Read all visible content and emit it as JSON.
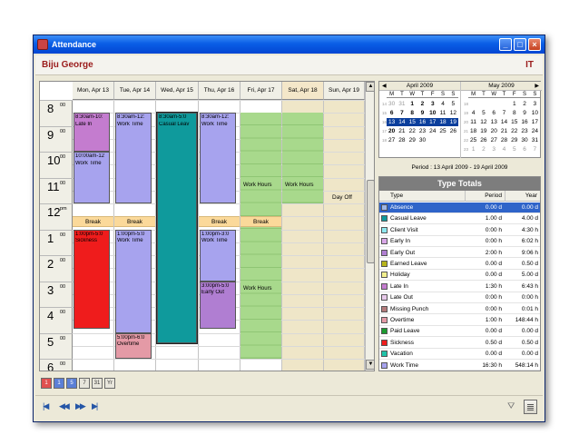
{
  "window": {
    "title": "Attendance"
  },
  "header": {
    "user": "Biju George",
    "dept": "IT"
  },
  "days": [
    {
      "label": "Mon, Apr 13",
      "weekend": false
    },
    {
      "label": "Tue, Apr 14",
      "weekend": false
    },
    {
      "label": "Wed, Apr 15",
      "weekend": false
    },
    {
      "label": "Thu, Apr 16",
      "weekend": false
    },
    {
      "label": "Fri, Apr 17",
      "weekend": false
    },
    {
      "label": "Sat, Apr 18",
      "weekend": true
    },
    {
      "label": "Sun, Apr 19",
      "weekend": false
    }
  ],
  "hours": [
    {
      "num": "8",
      "min": "00"
    },
    {
      "num": "9",
      "min": "00"
    },
    {
      "num": "10",
      "min": "00"
    },
    {
      "num": "11",
      "min": "00"
    },
    {
      "num": "12",
      "min": "pm"
    },
    {
      "num": "1",
      "min": "00"
    },
    {
      "num": "2",
      "min": "00"
    },
    {
      "num": "3",
      "min": "00"
    },
    {
      "num": "4",
      "min": "00"
    },
    {
      "num": "5",
      "min": "00"
    },
    {
      "num": "6",
      "min": "00"
    }
  ],
  "appointments": [
    {
      "day": 0,
      "time": "8:30am-10:",
      "title": "Late In",
      "color": "#c47ccf"
    },
    {
      "day": 0,
      "time": "10:00am-12",
      "title": "Work Time",
      "color": "#a7a3ee"
    },
    {
      "day": 0,
      "time": "1:00pm-5:0",
      "title": "Sickness",
      "color": "#ef1c1c"
    },
    {
      "day": 1,
      "time": "8:30am-12:",
      "title": "Work Time",
      "color": "#a7a3ee"
    },
    {
      "day": 1,
      "time": "1:00pm-5:0",
      "title": "Work Time",
      "color": "#a7a3ee"
    },
    {
      "day": 1,
      "time": "5:00pm-6:0",
      "title": "Overtime",
      "color": "#e49aa6"
    },
    {
      "day": 2,
      "time": "8:30am-5:0",
      "title": "Casual Leav",
      "color": "#0f9a9c"
    },
    {
      "day": 3,
      "time": "8:30am-12:",
      "title": "Work Time",
      "color": "#a7a3ee"
    },
    {
      "day": 3,
      "time": "1:00pm-3:0",
      "title": "Work Time",
      "color": "#a7a3ee"
    },
    {
      "day": 3,
      "time": "3:00pm-5:0",
      "title": "Early Out",
      "color": "#b07ed2"
    }
  ],
  "breaks": {
    "label": "Break",
    "days": [
      0,
      1,
      3,
      4
    ]
  },
  "work_hours_label": "Work Hours",
  "day_off_label": "Day Off",
  "calendar": {
    "months": [
      {
        "title": "April 2009",
        "dow": [
          "M",
          "T",
          "W",
          "T",
          "F",
          "S",
          "S"
        ],
        "weeks": [
          {
            "wk": "14",
            "days": [
              {
                "d": "30",
                "c": "other"
              },
              {
                "d": "31",
                "c": "other"
              },
              {
                "d": "1",
                "c": "bold"
              },
              {
                "d": "2",
                "c": "bold"
              },
              {
                "d": "3",
                "c": "bold"
              },
              {
                "d": "4",
                "c": ""
              },
              {
                "d": "5",
                "c": ""
              }
            ]
          },
          {
            "wk": "15",
            "days": [
              {
                "d": "6",
                "c": "bold"
              },
              {
                "d": "7",
                "c": "bold"
              },
              {
                "d": "8",
                "c": "bold"
              },
              {
                "d": "9",
                "c": "bold"
              },
              {
                "d": "10",
                "c": "bold"
              },
              {
                "d": "11",
                "c": ""
              },
              {
                "d": "12",
                "c": ""
              }
            ]
          },
          {
            "wk": "16",
            "days": [
              {
                "d": "13",
                "c": "sel"
              },
              {
                "d": "14",
                "c": "sel"
              },
              {
                "d": "15",
                "c": "sel"
              },
              {
                "d": "16",
                "c": "sel"
              },
              {
                "d": "17",
                "c": "sel"
              },
              {
                "d": "18",
                "c": "sel"
              },
              {
                "d": "19",
                "c": "sel"
              }
            ]
          },
          {
            "wk": "17",
            "days": [
              {
                "d": "20",
                "c": "bold"
              },
              {
                "d": "21",
                "c": ""
              },
              {
                "d": "22",
                "c": ""
              },
              {
                "d": "23",
                "c": ""
              },
              {
                "d": "24",
                "c": ""
              },
              {
                "d": "25",
                "c": ""
              },
              {
                "d": "26",
                "c": ""
              }
            ]
          },
          {
            "wk": "18",
            "days": [
              {
                "d": "27",
                "c": ""
              },
              {
                "d": "28",
                "c": ""
              },
              {
                "d": "29",
                "c": ""
              },
              {
                "d": "30",
                "c": ""
              },
              {
                "d": "",
                "c": ""
              },
              {
                "d": "",
                "c": ""
              },
              {
                "d": "",
                "c": ""
              }
            ]
          }
        ]
      },
      {
        "title": "May 2009",
        "dow": [
          "M",
          "T",
          "W",
          "T",
          "F",
          "S",
          "S"
        ],
        "weeks": [
          {
            "wk": "18",
            "days": [
              {
                "d": "",
                "c": ""
              },
              {
                "d": "",
                "c": ""
              },
              {
                "d": "",
                "c": ""
              },
              {
                "d": "",
                "c": ""
              },
              {
                "d": "1",
                "c": ""
              },
              {
                "d": "2",
                "c": ""
              },
              {
                "d": "3",
                "c": ""
              }
            ]
          },
          {
            "wk": "19",
            "days": [
              {
                "d": "4",
                "c": ""
              },
              {
                "d": "5",
                "c": ""
              },
              {
                "d": "6",
                "c": ""
              },
              {
                "d": "7",
                "c": ""
              },
              {
                "d": "8",
                "c": ""
              },
              {
                "d": "9",
                "c": ""
              },
              {
                "d": "10",
                "c": ""
              }
            ]
          },
          {
            "wk": "20",
            "days": [
              {
                "d": "11",
                "c": ""
              },
              {
                "d": "12",
                "c": ""
              },
              {
                "d": "13",
                "c": ""
              },
              {
                "d": "14",
                "c": ""
              },
              {
                "d": "15",
                "c": ""
              },
              {
                "d": "16",
                "c": ""
              },
              {
                "d": "17",
                "c": ""
              }
            ]
          },
          {
            "wk": "21",
            "days": [
              {
                "d": "18",
                "c": ""
              },
              {
                "d": "19",
                "c": ""
              },
              {
                "d": "20",
                "c": ""
              },
              {
                "d": "21",
                "c": ""
              },
              {
                "d": "22",
                "c": ""
              },
              {
                "d": "23",
                "c": ""
              },
              {
                "d": "24",
                "c": ""
              }
            ]
          },
          {
            "wk": "22",
            "days": [
              {
                "d": "25",
                "c": ""
              },
              {
                "d": "26",
                "c": ""
              },
              {
                "d": "27",
                "c": ""
              },
              {
                "d": "28",
                "c": ""
              },
              {
                "d": "29",
                "c": ""
              },
              {
                "d": "30",
                "c": ""
              },
              {
                "d": "31",
                "c": ""
              }
            ]
          },
          {
            "wk": "23",
            "days": [
              {
                "d": "1",
                "c": "other"
              },
              {
                "d": "2",
                "c": "other"
              },
              {
                "d": "3",
                "c": "other"
              },
              {
                "d": "4",
                "c": "other"
              },
              {
                "d": "5",
                "c": "other"
              },
              {
                "d": "6",
                "c": "other"
              },
              {
                "d": "7",
                "c": "other"
              }
            ]
          }
        ]
      }
    ]
  },
  "period": "Period : 13 April 2009 - 19 April 2009",
  "totals": {
    "title": "Type Totals",
    "headers": {
      "type": "Type",
      "period": "Period",
      "year": "Year"
    },
    "rows": [
      {
        "type": "Absence",
        "period": "0.00 d",
        "year": "0.00 d",
        "color": "#9fb6e6",
        "selected": true
      },
      {
        "type": "Casual Leave",
        "period": "1.00 d",
        "year": "4.00 d",
        "color": "#0f9a9c",
        "selected": false
      },
      {
        "type": "Client Visit",
        "period": "0:00 h",
        "year": "4:30 h",
        "color": "#8ee8ef",
        "selected": false
      },
      {
        "type": "Early In",
        "period": "0:00 h",
        "year": "6:02 h",
        "color": "#d9a7e8",
        "selected": false
      },
      {
        "type": "Early Out",
        "period": "2:00 h",
        "year": "9:06 h",
        "color": "#b07ed2",
        "selected": false
      },
      {
        "type": "Earned Leave",
        "period": "0.00 d",
        "year": "0.50 d",
        "color": "#b7b419",
        "selected": false
      },
      {
        "type": "Holiday",
        "period": "0.00 d",
        "year": "5.00 d",
        "color": "#f2ef8e",
        "selected": false
      },
      {
        "type": "Late In",
        "period": "1:30 h",
        "year": "6:43 h",
        "color": "#c47ccf",
        "selected": false
      },
      {
        "type": "Late Out",
        "period": "0:00 h",
        "year": "0:00 h",
        "color": "#e7c9e9",
        "selected": false
      },
      {
        "type": "Missing Punch",
        "period": "0:00 h",
        "year": "0:01 h",
        "color": "#b47b7b",
        "selected": false
      },
      {
        "type": "Overtime",
        "period": "1:00 h",
        "year": "148:44 h",
        "color": "#e49aa6",
        "selected": false
      },
      {
        "type": "Paid Leave",
        "period": "0.00 d",
        "year": "0.00 d",
        "color": "#1a9b2f",
        "selected": false
      },
      {
        "type": "Sickness",
        "period": "0.50 d",
        "year": "0.50 d",
        "color": "#ef1c1c",
        "selected": false
      },
      {
        "type": "Vacation",
        "period": "0.00 d",
        "year": "0.00 d",
        "color": "#1fc3a9",
        "selected": false
      },
      {
        "type": "Work Time",
        "period": "16:30 h",
        "year": "548:14 h",
        "color": "#a7a3ee",
        "selected": false
      }
    ]
  },
  "view_buttons": [
    {
      "label": "1",
      "name": "view-day-button",
      "style": "red"
    },
    {
      "label": "1",
      "name": "view-workday-button",
      "style": "blue"
    },
    {
      "label": "5",
      "name": "view-workweek-button",
      "style": "blue"
    },
    {
      "label": "7",
      "name": "view-week-button",
      "style": "plain"
    },
    {
      "label": "31",
      "name": "view-month-button",
      "style": "plain"
    },
    {
      "label": "Yr",
      "name": "view-year-button",
      "style": "plain"
    }
  ],
  "nav_buttons": [
    {
      "label": "|◀",
      "name": "first-button"
    },
    {
      "label": "◀◀",
      "name": "previous-button"
    },
    {
      "label": "▶▶",
      "name": "next-button"
    },
    {
      "label": "▶|",
      "name": "last-button"
    }
  ],
  "icons": {
    "filter": "filter-icon",
    "grid": "grid-view-icon"
  }
}
